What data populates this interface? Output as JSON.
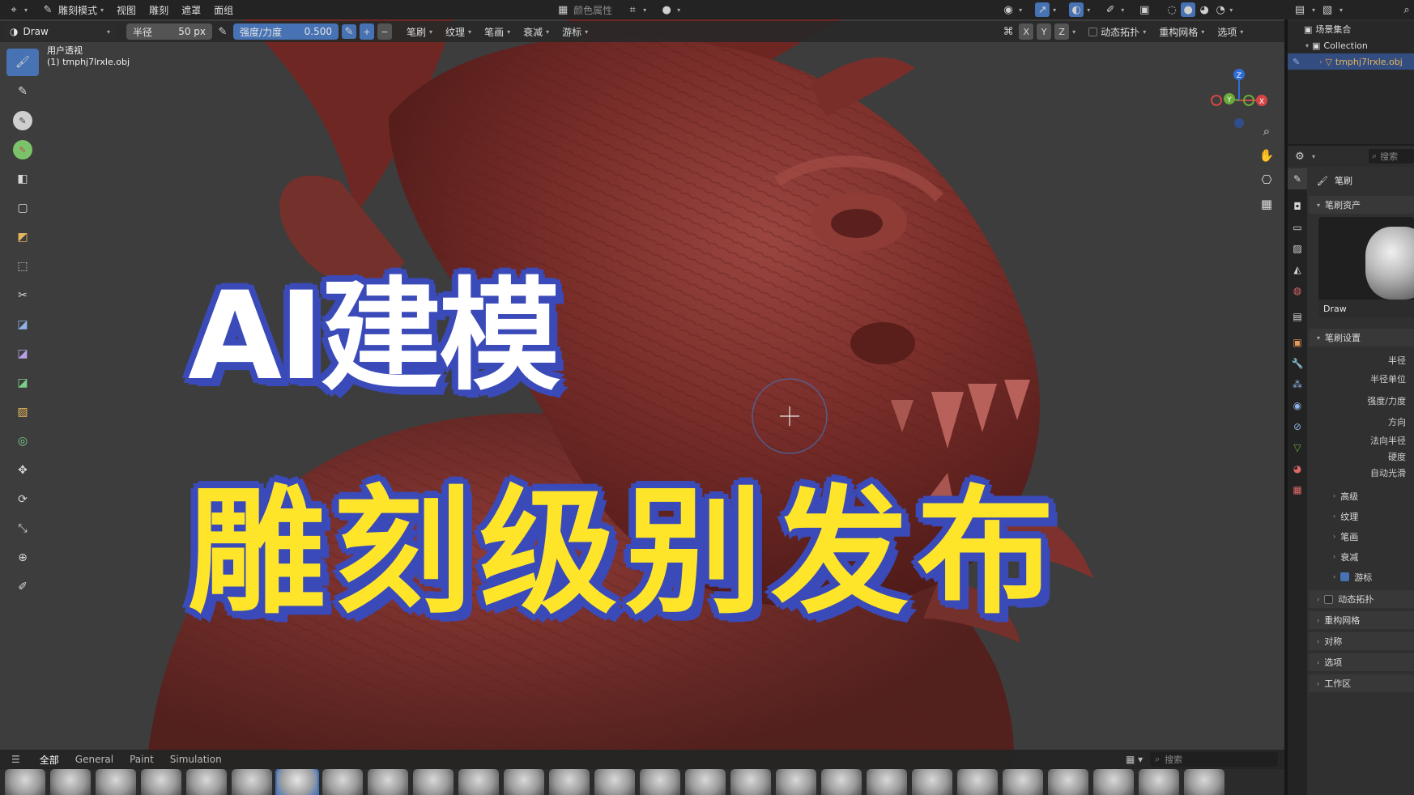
{
  "topbar": {
    "mode_label": "雕刻模式",
    "menus": [
      "视图",
      "雕刻",
      "遮罩",
      "面组"
    ],
    "color_attr_label": "颜色属性"
  },
  "toolheader": {
    "brush_name": "Draw",
    "radius_label": "半径",
    "radius_value": "50 px",
    "strength_label": "强度/力度",
    "strength_value": "0.500",
    "plus": "+",
    "minus": "−",
    "menus": [
      "笔刷",
      "纹理",
      "笔画",
      "衰减",
      "游标"
    ],
    "axes": [
      "X",
      "Y",
      "Z"
    ],
    "dyntopo_label": "动态拓扑",
    "remesh_label": "重构网格",
    "options_label": "选项"
  },
  "viewport": {
    "view_name": "用户透视",
    "object_label": "(1) tmphj7lrxle.obj",
    "headline_1": "AI建模",
    "headline_2": "雕刻级别发布",
    "gizmo_axes": {
      "x": "X",
      "y": "Y",
      "z": "Z"
    }
  },
  "shelf": {
    "tabs": [
      "全部",
      "General",
      "Paint",
      "Simulation"
    ],
    "search_placeholder": "搜索"
  },
  "outliner": {
    "scene_collection": "场景集合",
    "collection": "Collection",
    "object": "tmphj7lrxle.obj"
  },
  "properties": {
    "search_placeholder": "搜索",
    "title": "笔刷",
    "brush_asset_panel": "笔刷资产",
    "asset_name": "Draw",
    "brush_settings_panel": "笔刷设置",
    "fields": [
      "半径",
      "半径单位",
      "强度/力度",
      "方向",
      "法向半径",
      "硬度",
      "自动光滑"
    ],
    "subpanels": [
      "高级",
      "纹理",
      "笔画",
      "衰减"
    ],
    "cursor_panel": "游标",
    "panels": [
      "动态拓扑",
      "重构网格",
      "对称",
      "选项",
      "工作区"
    ]
  },
  "colors": {
    "accent": "#4772b3",
    "model": "#7a2e2a",
    "headline_outline": "#3a4ab8",
    "headline_yellow": "#ffe52a"
  }
}
